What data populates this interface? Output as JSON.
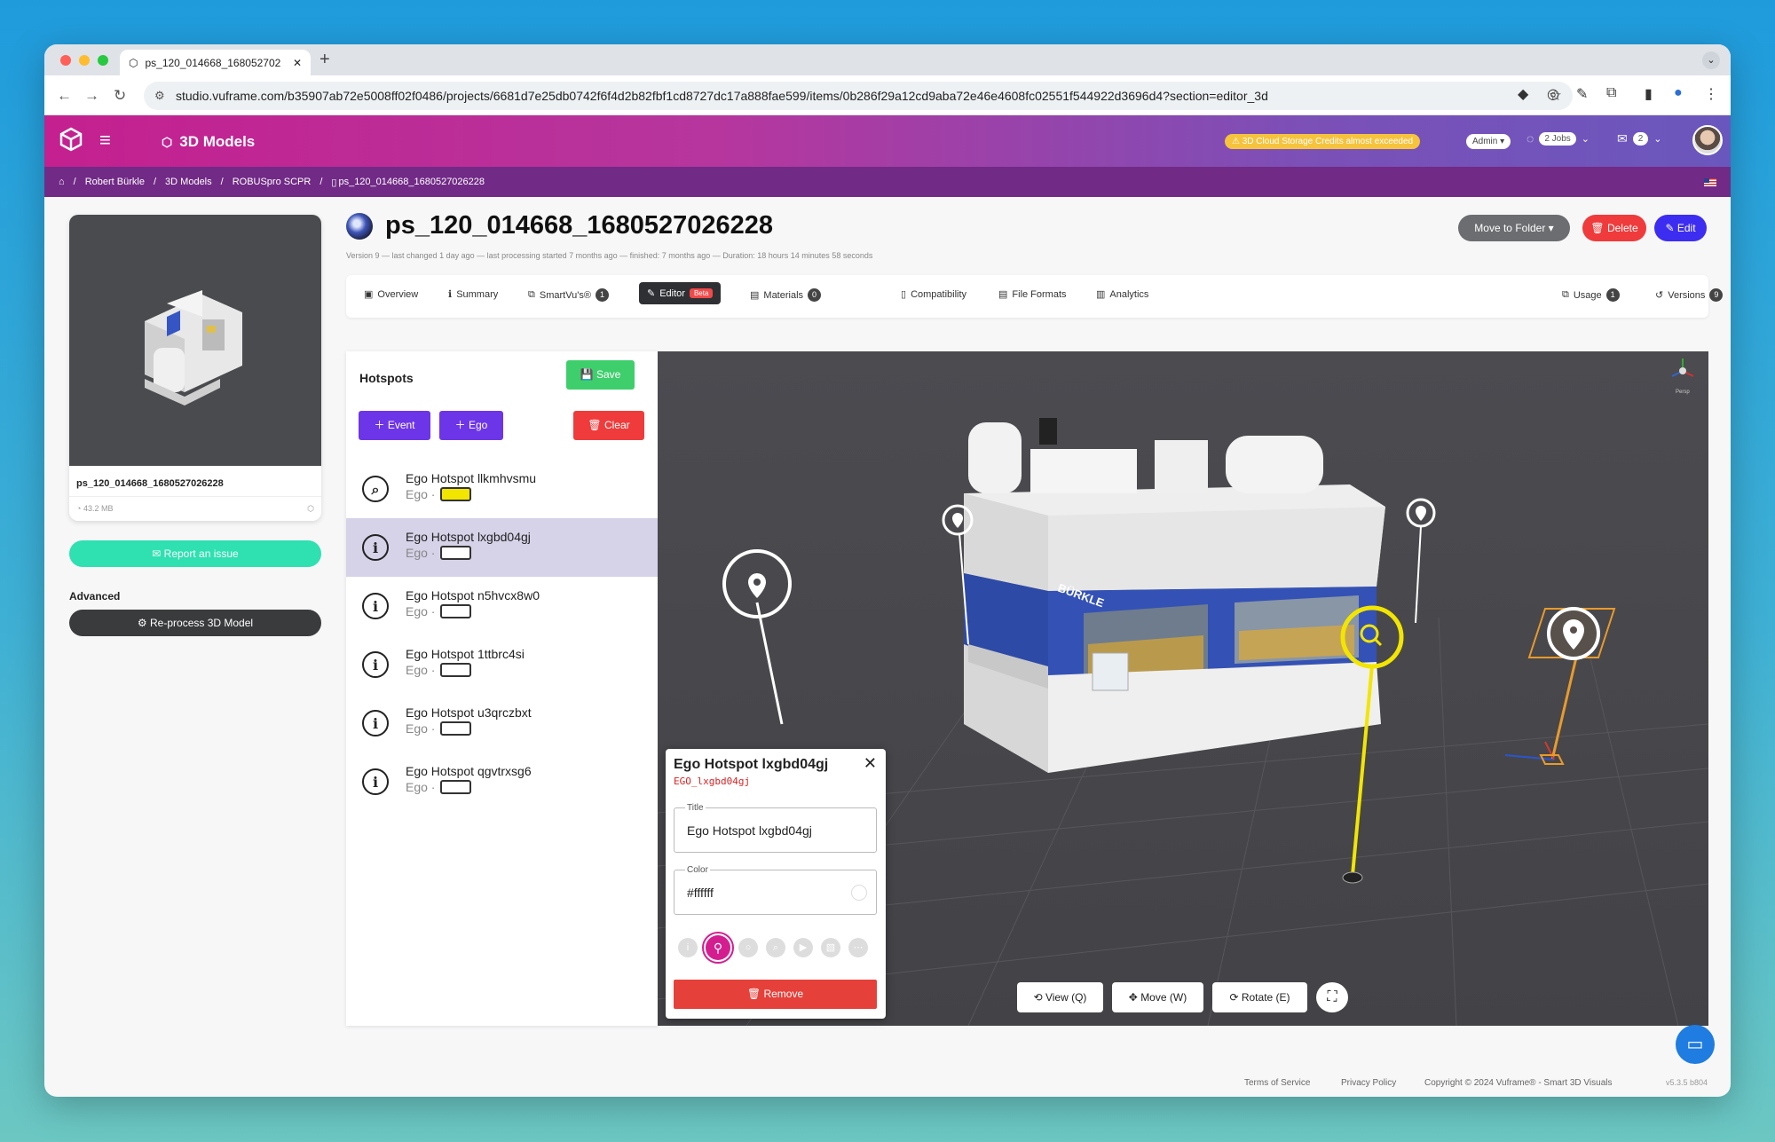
{
  "browser": {
    "tab_title": "ps_120_014668_168052702",
    "url": "studio.vuframe.com/b35907ab72e5008ff02f0486/projects/6681d7e25db0742f6f4d2b82fbf1cd8727dc17a888fae599/items/0b286f29a12cd9aba72e46e4608fc02551f544922d3696d4?section=editor_3d"
  },
  "header": {
    "app_title": "3D Models",
    "warning": "3D Cloud Storage Credits almost exceeded",
    "admin_label": "Admin",
    "jobs_label": "2 Jobs",
    "mail_count": "2"
  },
  "breadcrumbs": [
    "Robert Bürkle",
    "3D Models",
    "ROBUSpro SCPR",
    "ps_120_014668_1680527026228"
  ],
  "sidebar": {
    "card_name": "ps_120_014668_1680527026228",
    "card_size": "43.2 MB",
    "report_label": "Report an issue",
    "advanced_label": "Advanced",
    "reprocess_label": "Re-process 3D Model"
  },
  "page": {
    "title": "ps_120_014668_1680527026228",
    "version_info": "Version 9 — last changed 1 day ago — last processing started 7 months ago — finished: 7 months ago — Duration: 18 hours 14 minutes 58 seconds",
    "move_label": "Move to Folder",
    "delete_label": "Delete",
    "edit_label": "Edit"
  },
  "tabs": {
    "overview": "Overview",
    "summary": "Summary",
    "smartvus": "SmartVu's®",
    "smartvus_count": "1",
    "editor": "Editor",
    "beta": "Beta",
    "materials": "Materials",
    "materials_count": "0",
    "compat": "Compatibility",
    "formats": "File Formats",
    "analytics": "Analytics",
    "usage": "Usage",
    "usage_count": "1",
    "versions": "Versions",
    "versions_count": "9"
  },
  "hotspots": {
    "title": "Hotspots",
    "save": "Save",
    "event": "Event",
    "ego": "Ego",
    "clear": "Clear",
    "items": [
      {
        "name": "Ego Hotspot llkmhvsmu",
        "type": "Ego ·",
        "color": "#f2e500"
      },
      {
        "name": "Ego Hotspot lxgbd04gj",
        "type": "Ego ·",
        "color": "#ffffff"
      },
      {
        "name": "Ego Hotspot n5hvcx8w0",
        "type": "Ego ·",
        "color": "#ffffff"
      },
      {
        "name": "Ego Hotspot 1ttbrc4si",
        "type": "Ego ·",
        "color": "#ffffff"
      },
      {
        "name": "Ego Hotspot u3qrczbxt",
        "type": "Ego ·",
        "color": "#ffffff"
      },
      {
        "name": "Ego Hotspot qgvtrxsg6",
        "type": "Ego ·",
        "color": "#ffffff"
      }
    ]
  },
  "popup": {
    "title": "Ego Hotspot lxgbd04gj",
    "id": "EGO_lxgbd04gj",
    "title_label": "Title",
    "title_value": "Ego Hotspot lxgbd04gj",
    "color_label": "Color",
    "color_value": "#ffffff",
    "remove": "Remove"
  },
  "viewport": {
    "view": "View (Q)",
    "move": "Move (W)",
    "rotate": "Rotate (E)",
    "gizmo_label": "Persp",
    "machine_logo": "BÜRKLE"
  },
  "footer": {
    "terms": "Terms of Service",
    "privacy": "Privacy Policy",
    "copyright": "Copyright © 2024 Vuframe® - Smart 3D Visuals",
    "version": "v5.3.5 b804"
  },
  "colors": {
    "accent": "#c4208f",
    "purple": "#712a86",
    "save": "#3ecf6c",
    "danger": "#ef3b3b",
    "edit": "#3d2df0"
  }
}
